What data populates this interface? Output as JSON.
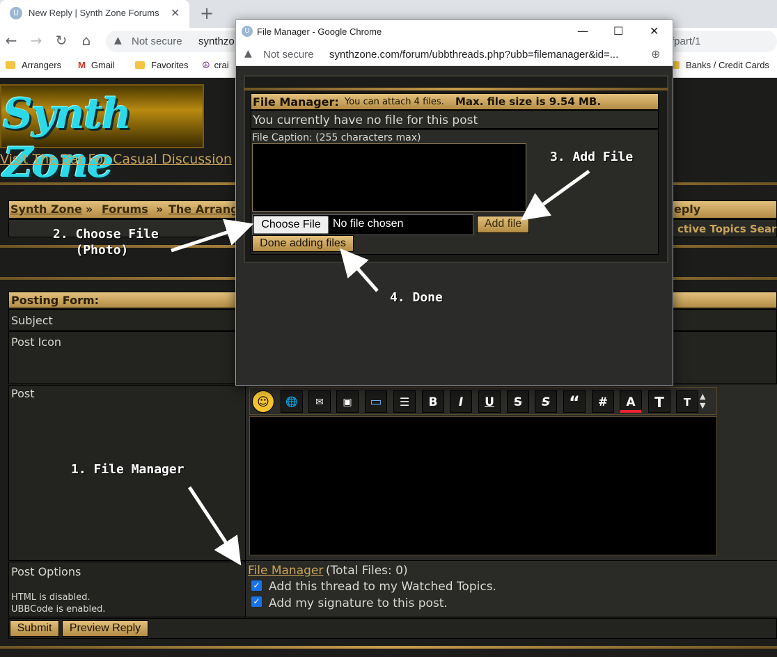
{
  "browser": {
    "tab_title": "New Reply | Synth Zone Forums",
    "not_secure": "Not secure",
    "url_visible": "synthzo",
    "url_tail": "fpart/1",
    "bookmarks": [
      "Arrangers",
      "Gmail",
      "Favorites",
      "crai",
      "Banks / Credit Cards"
    ]
  },
  "popup": {
    "window_title": "File Manager - Google Chrome",
    "not_secure": "Not secure",
    "url": "synthzone.com/forum/ubbthreads.php?ubb=filemanager&id=...",
    "header_bold": "File Manager:",
    "header_small": "You can attach 4 files.",
    "header_max": "Max. file size is 9.54 MB.",
    "no_file": "You currently have no file for this post",
    "caption_label": "File Caption: (255 characters max)",
    "choose_file": "Choose File",
    "no_file_chosen": "No file chosen",
    "add_file": "Add file",
    "done": "Done adding files"
  },
  "forum": {
    "logo_text": "Synth Zone",
    "bar_link": "Visit The Bar For Casual Discussion",
    "breadcrumb": [
      "Synth Zone",
      "»",
      "Forums",
      "»",
      "The Arrang"
    ],
    "breadcrumb_right": "eply",
    "nav_links": "ctive Topics   Sear",
    "posting_form": "Posting Form:",
    "subject_label": "Subject",
    "post_icon_label": "Post Icon",
    "post_label": "Post",
    "post_options_label": "Post Options",
    "html_disabled": "HTML is disabled.",
    "ubbcode_enabled": "UBBCode is enabled.",
    "file_manager_link": "File Manager",
    "total_files": "(Total Files: 0)",
    "watch_label": "Add this thread to my Watched Topics.",
    "signature_label": "Add my signature to this post.",
    "submit": "Submit",
    "preview": "Preview Reply",
    "editor_buttons": [
      "B",
      "I",
      "U",
      "S",
      "S",
      "“",
      "#",
      "A",
      "T",
      "T"
    ]
  },
  "annotations": {
    "step1": "1. File Manager",
    "step2": "2. Choose File\n   (Photo)",
    "step3": "3. Add File",
    "step4": "4. Done"
  }
}
